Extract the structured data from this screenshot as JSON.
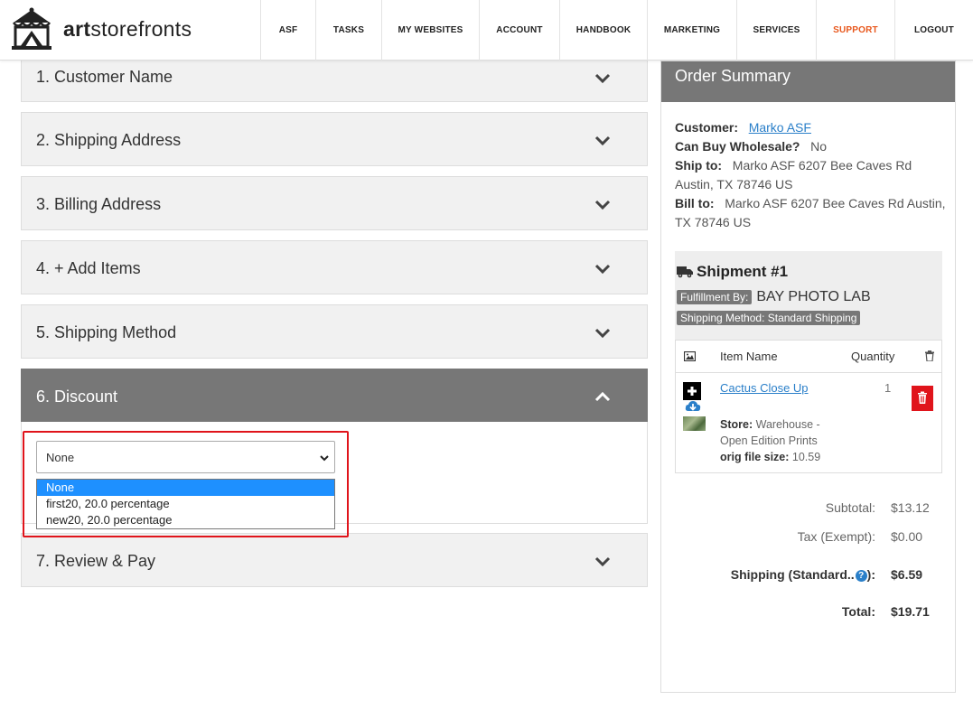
{
  "brand": {
    "name_bold": "art",
    "name_rest": "storefronts",
    "logo_icon": "storefront-tent-icon"
  },
  "nav": {
    "items": [
      {
        "label": "ASF"
      },
      {
        "label": "TASKS"
      },
      {
        "label": "MY WEBSITES"
      },
      {
        "label": "ACCOUNT"
      },
      {
        "label": "HANDBOOK"
      },
      {
        "label": "MARKETING"
      },
      {
        "label": "SERVICES"
      },
      {
        "label": "SUPPORT"
      },
      {
        "label": "LOGOUT"
      }
    ],
    "active_color": "#e8571c"
  },
  "steps": {
    "s1": "1. Customer Name",
    "s2": "2. Shipping Address",
    "s3": "3. Billing Address",
    "s4": "4. + Add Items",
    "s5": "5. Shipping Method",
    "s6": "6. Discount",
    "s7": "7. Review & Pay"
  },
  "discount": {
    "selected": "None",
    "options": [
      "None",
      "first20, 20.0 percentage",
      "new20, 20.0 percentage"
    ]
  },
  "summary": {
    "title": "Order Summary",
    "customer_label": "Customer:",
    "customer_value": "Marko ASF",
    "wholesale_label": "Can Buy Wholesale?",
    "wholesale_value": "No",
    "shipto_label": "Ship to:",
    "shipto_line1": "Marko ASF 6207 Bee Caves Rd",
    "shipto_line2": "Austin, TX 78746 US",
    "billto_label": "Bill to:",
    "billto_line1": "Marko ASF 6207 Bee Caves Rd Austin,",
    "billto_line2": "TX 78746 US"
  },
  "shipment": {
    "title": "Shipment #1",
    "fulfillment_tag": "Fulfillment By:",
    "fulfillment_value": "BAY PHOTO LAB",
    "method_tag": "Shipping Method: Standard Shipping",
    "col_item": "Item Name",
    "col_qty": "Quantity",
    "item": {
      "name": "Cactus Close Up",
      "qty": "1",
      "store_label": "Store:",
      "store_line1": "Warehouse -",
      "store_line2": "Open Edition Prints",
      "size_label": "orig file size:",
      "size_value": "10.59"
    }
  },
  "totals": {
    "subtotal_label": "Subtotal:",
    "subtotal_value": "$13.12",
    "tax_label": "Tax (Exempt):",
    "tax_value": "$0.00",
    "shipping_label_a": "Shipping (Standard..",
    "shipping_label_b": "):",
    "shipping_help": "?",
    "shipping_value": "$6.59",
    "total_label": "Total:",
    "total_value": "$19.71"
  },
  "colors": {
    "header_gray": "#777777",
    "link_blue": "#2a7fc9",
    "delete_red": "#e0141b",
    "highlight_red": "#e0141b"
  }
}
